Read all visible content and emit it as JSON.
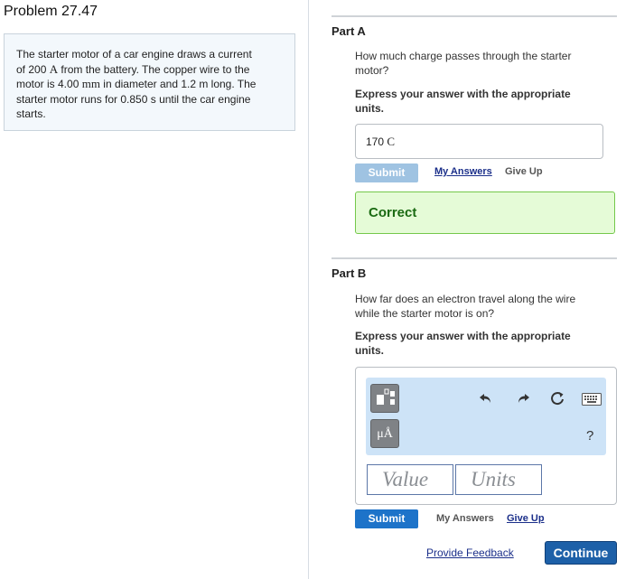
{
  "problem": {
    "title": "Problem 27.47",
    "text_line1": "The starter motor of a car engine draws a current",
    "text_line2_a": "of 200 ",
    "text_line2_unit": "A",
    "text_line2_b": " from the battery. The copper wire to the",
    "text_line3_a": "motor is 4.00 ",
    "text_line3_unit": "mm",
    "text_line3_b": " in diameter and 1.2 m long. The",
    "text_line4": "starter motor runs for 0.850 s until the car engine",
    "text_line5": "starts."
  },
  "part_a": {
    "title": "Part A",
    "question_line1": "How much charge passes through the starter",
    "question_line2": "motor?",
    "instruction_line1": "Express your answer with the appropriate",
    "instruction_line2": "units.",
    "answer_value": "170",
    "answer_unit": "C",
    "submit_label": "Submit",
    "my_answers_label": "My Answers",
    "give_up_label": "Give Up",
    "result_label": "Correct"
  },
  "part_b": {
    "title": "Part B",
    "question_line1": "How far does an electron travel along the wire",
    "question_line2": "while the starter motor is on?",
    "instruction_line1": "Express your answer with the appropriate",
    "instruction_line2": "units.",
    "units_button_label": "μÅ",
    "help_label": "?",
    "value_placeholder": "Value",
    "units_placeholder": "Units",
    "submit_label": "Submit",
    "my_answers_label": "My Answers",
    "give_up_label": "Give Up"
  },
  "footer": {
    "feedback_label": "Provide Feedback",
    "continue_label": "Continue"
  },
  "icons": {
    "templates": "templates-icon",
    "units": "units-icon",
    "undo": "undo-icon",
    "redo": "redo-icon",
    "reset": "reset-icon",
    "keyboard": "keyboard-icon",
    "help": "help-icon"
  },
  "colors": {
    "correct_bg": "#e5fbd7",
    "correct_border": "#74c84b",
    "submit_enabled": "#1d73c9",
    "submit_disabled": "#9fc3e2",
    "continue_bg": "#1d60a8",
    "toolbar_bg": "#cde3f7"
  }
}
